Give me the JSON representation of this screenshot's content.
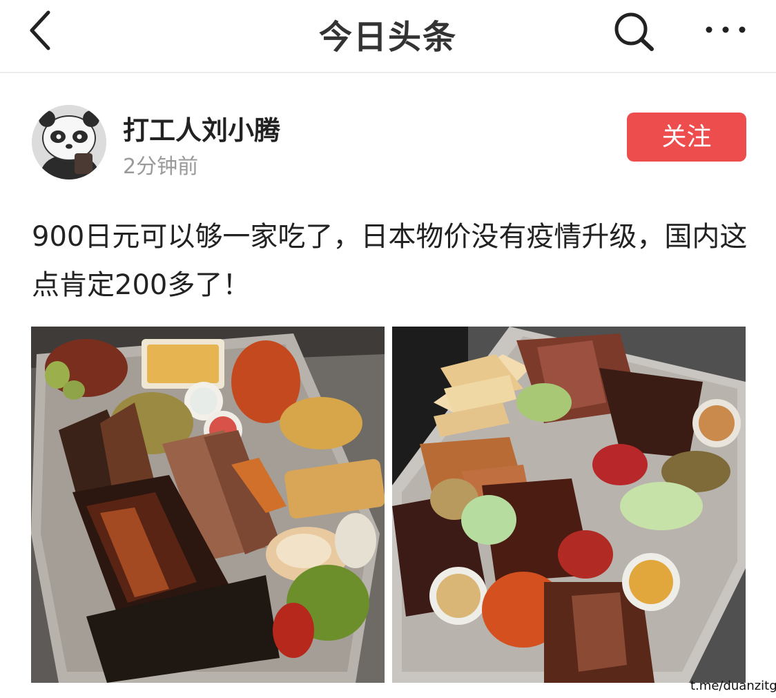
{
  "header": {
    "title": "今日头条",
    "back_icon": "chevron-left-icon",
    "search_icon": "search-icon",
    "more_icon": "more-horizontal-icon"
  },
  "author": {
    "name": "打工人刘小腾",
    "time": "2分钟前",
    "avatar": "panda-avatar",
    "follow_label": "关注",
    "follow_color": "#ee4d4d"
  },
  "post": {
    "text": "900日元可以够一家吃了，日本物价没有疫情升级，国内这点肯定200多了！"
  },
  "images": [
    {
      "description": "bbq-platter-photo-1"
    },
    {
      "description": "bbq-platter-photo-2"
    }
  ],
  "watermark": "t.me/duanzitg"
}
